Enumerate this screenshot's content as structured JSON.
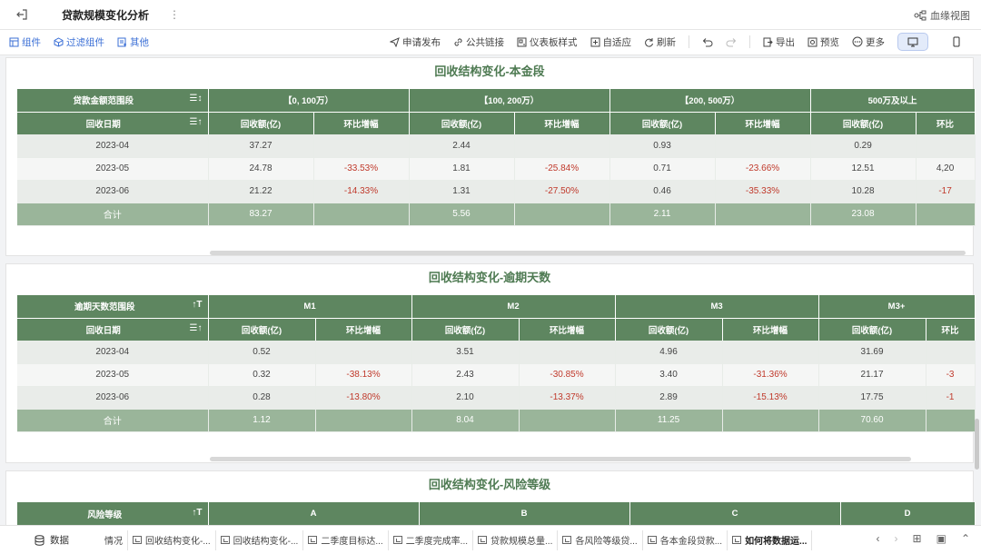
{
  "header": {
    "title": "贷款规模变化分析",
    "lineage": "血缘视图"
  },
  "toolbar": {
    "left": [
      "组件",
      "过滤组件",
      "其他"
    ],
    "right": [
      "申请发布",
      "公共链接",
      "仪表板样式",
      "自适应",
      "刷新",
      "导出",
      "预览",
      "更多"
    ]
  },
  "panel1": {
    "title": "回收结构变化-本金段",
    "row1_first": "贷款金额范围段",
    "groups": [
      "【0, 100万）",
      "【100, 200万）",
      "【200, 500万）",
      "500万及以上"
    ],
    "row2_first": "回收日期",
    "sub": [
      "回收额(亿)",
      "环比增幅",
      "回收额(亿)",
      "环比增幅",
      "回收额(亿)",
      "环比增幅",
      "回收额(亿)",
      "环比"
    ],
    "rows": [
      [
        "2023-04",
        "37.27",
        "",
        "2.44",
        "",
        "0.93",
        "",
        "0.29",
        ""
      ],
      [
        "2023-05",
        "24.78",
        "-33.53%",
        "1.81",
        "-25.84%",
        "0.71",
        "-23.66%",
        "12.51",
        "4,20"
      ],
      [
        "2023-06",
        "21.22",
        "-14.33%",
        "1.31",
        "-27.50%",
        "0.46",
        "-35.33%",
        "10.28",
        "-17"
      ]
    ],
    "total": [
      "合计",
      "83.27",
      "",
      "5.56",
      "",
      "2.11",
      "",
      "23.08",
      ""
    ]
  },
  "panel2": {
    "title": "回收结构变化-逾期天数",
    "row1_first": "逾期天数范围段",
    "groups": [
      "M1",
      "M2",
      "M3",
      "M3+"
    ],
    "row2_first": "回收日期",
    "sub": [
      "回收额(亿)",
      "环比增幅",
      "回收额(亿)",
      "环比增幅",
      "回收额(亿)",
      "环比增幅",
      "回收额(亿)",
      "环比"
    ],
    "rows": [
      [
        "2023-04",
        "0.52",
        "",
        "3.51",
        "",
        "4.96",
        "",
        "31.69",
        ""
      ],
      [
        "2023-05",
        "0.32",
        "-38.13%",
        "2.43",
        "-30.85%",
        "3.40",
        "-31.36%",
        "21.17",
        "-3"
      ],
      [
        "2023-06",
        "0.28",
        "-13.80%",
        "2.10",
        "-13.37%",
        "2.89",
        "-15.13%",
        "17.75",
        "-1"
      ]
    ],
    "total": [
      "合计",
      "1.12",
      "",
      "8.04",
      "",
      "11.25",
      "",
      "70.60",
      ""
    ]
  },
  "panel3": {
    "title": "回收结构变化-风险等级",
    "row1_first": "风险等级",
    "groups": [
      "A",
      "B",
      "C",
      "D"
    ]
  },
  "bottom": {
    "data": "数据",
    "partial": "情况",
    "tabs": [
      "回收结构变化-...",
      "回收结构变化-...",
      "二季度目标达...",
      "二季度完成率...",
      "贷款规模总量...",
      "各风险等级贷...",
      "各本金段贷款...",
      "如何将数据运..."
    ]
  }
}
